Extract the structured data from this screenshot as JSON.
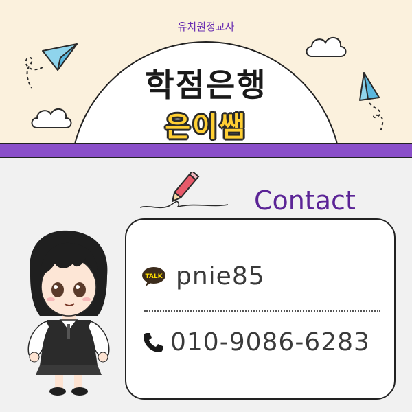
{
  "header": {
    "subtitle": "유치원정교사",
    "title": "학점은행",
    "name": "은이쌤"
  },
  "contact": {
    "label": "Contact",
    "kakao_badge": "TALK",
    "kakao_id": "pnie85",
    "phone": "010-9086-6283"
  },
  "colors": {
    "accent_purple": "#8a4fc9",
    "name_yellow": "#ffcf33",
    "header_bg": "#fbf1dd"
  },
  "icons": [
    "paper-plane-icon",
    "cloud-icon",
    "pencil-icon",
    "kakaotalk-icon",
    "phone-icon"
  ]
}
